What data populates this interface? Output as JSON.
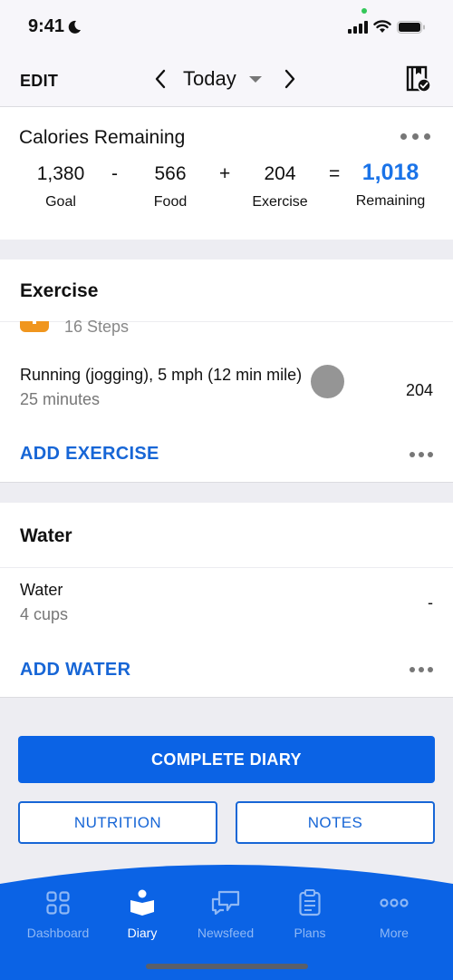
{
  "status_bar": {
    "time": "9:41",
    "icons": [
      "moon-icon",
      "signal-icon",
      "wifi-icon",
      "battery-icon"
    ]
  },
  "header": {
    "edit_label": "EDIT",
    "date_label": "Today",
    "icons": [
      "chevron-left-icon",
      "caret-down-icon",
      "chevron-right-icon",
      "diary-complete-icon"
    ]
  },
  "calories": {
    "title": "Calories Remaining",
    "goal": {
      "value": "1,380",
      "label": "Goal"
    },
    "op1": "-",
    "food": {
      "value": "566",
      "label": "Food"
    },
    "op2": "+",
    "exercise": {
      "value": "204",
      "label": "Exercise"
    },
    "op3": "=",
    "remaining": {
      "value": "1,018",
      "label": "Remaining"
    },
    "remaining_color": "#1a73e8"
  },
  "exercise": {
    "title": "Exercise",
    "steps_entry": {
      "text": "16 Steps",
      "icon": "steps-tracker-icon",
      "icon_color": "#f0961e"
    },
    "entries": [
      {
        "name": "Running (jogging), 5 mph (12 min mile)",
        "detail": "25 minutes",
        "calories": "204"
      }
    ],
    "add_label": "ADD EXERCISE"
  },
  "water": {
    "title": "Water",
    "entries": [
      {
        "name": "Water",
        "detail": "4 cups",
        "value": "-"
      }
    ],
    "add_label": "ADD WATER"
  },
  "actions": {
    "complete_diary": "COMPLETE DIARY",
    "nutrition": "NUTRITION",
    "notes": "NOTES"
  },
  "tabbar": {
    "tabs": [
      {
        "label": "Dashboard",
        "icon": "dashboard-icon",
        "active": false
      },
      {
        "label": "Diary",
        "icon": "diary-icon",
        "active": true
      },
      {
        "label": "Newsfeed",
        "icon": "newsfeed-icon",
        "active": false
      },
      {
        "label": "Plans",
        "icon": "plans-icon",
        "active": false
      },
      {
        "label": "More",
        "icon": "more-icon",
        "active": false
      }
    ],
    "background_color": "#0b63e5"
  }
}
